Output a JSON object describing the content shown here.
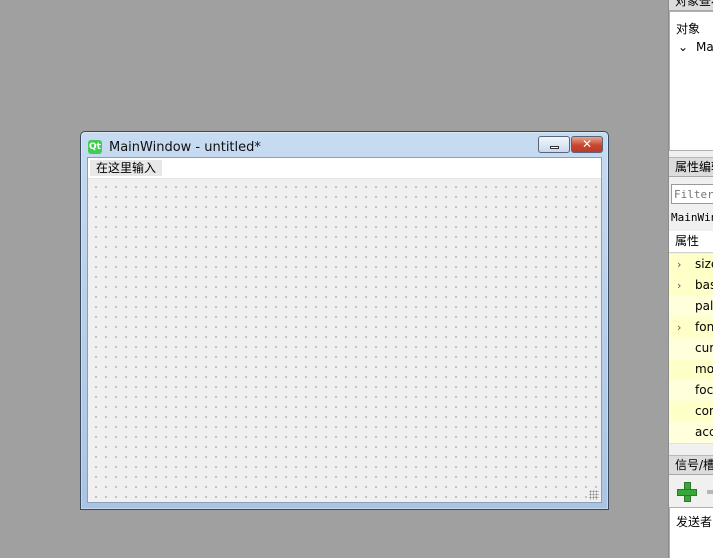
{
  "form_window": {
    "title": "MainWindow - untitled*",
    "logo_text": "Qt",
    "minimize_label": "",
    "close_label": "✕",
    "menu_placeholder": "在这里输入"
  },
  "object_inspector": {
    "title": "对象查看器",
    "column_header": "对象",
    "root_chevron": "⌄",
    "root_object": "MainWindow"
  },
  "property_editor": {
    "title": "属性编辑器",
    "filter_placeholder": "Filter",
    "class_label": "MainWindow : QMainWindow",
    "column_header": "属性",
    "rows": [
      {
        "name": "size",
        "chevron": "›",
        "highlight": true
      },
      {
        "name": "baseSize",
        "chevron": "›",
        "highlight": true
      },
      {
        "name": "palette",
        "chevron": "",
        "highlight": false
      },
      {
        "name": "font",
        "chevron": "›",
        "highlight": true
      },
      {
        "name": "cursor",
        "chevron": "",
        "highlight": false
      },
      {
        "name": "mouseTracking",
        "chevron": "",
        "highlight": true
      },
      {
        "name": "focusPolicy",
        "chevron": "",
        "highlight": false
      },
      {
        "name": "contextMenuPolicy",
        "chevron": "",
        "highlight": true
      },
      {
        "name": "acceptDrops",
        "chevron": "",
        "highlight": false
      }
    ]
  },
  "signal_slot_editor": {
    "title": "信号/槽编辑器",
    "column_header": "发送者"
  },
  "colors": {
    "highlight_row": "#ffffc8",
    "plain_row": "#ffffdc"
  }
}
